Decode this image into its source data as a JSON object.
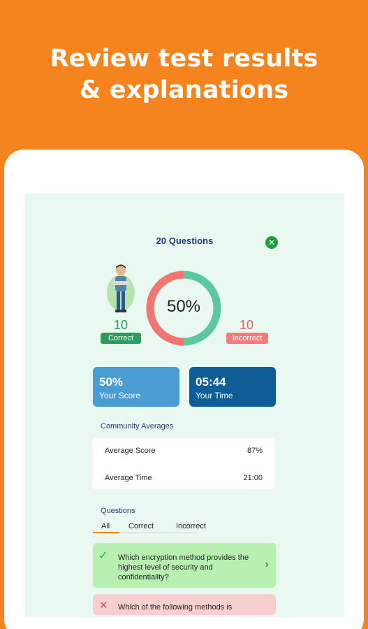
{
  "headline": {
    "line1": "Review test results",
    "line2": "& explanations"
  },
  "results": {
    "title": "20 Questions",
    "close_icon": "close-icon",
    "score_percent": 50,
    "score_label": "50%",
    "correct": {
      "count": "10",
      "label": "Correct"
    },
    "incorrect": {
      "count": "10",
      "label": "Incorrect"
    },
    "colors": {
      "correct": "#5BC8A0",
      "incorrect": "#F2766F",
      "accent": "#F5841F"
    },
    "score_card": {
      "value": "50%",
      "label": "Your Score"
    },
    "time_card": {
      "value": "05:44",
      "label": "Your Time"
    }
  },
  "community": {
    "title": "Community Averages",
    "rows": [
      {
        "label": "Average Score",
        "value": "87%"
      },
      {
        "label": "Average Time",
        "value": "21:00"
      }
    ]
  },
  "questions": {
    "title": "Questions",
    "tabs": [
      "All",
      "Correct",
      "Incorrect"
    ],
    "active_tab": "All",
    "items": [
      {
        "status": "correct",
        "icon": "check-icon",
        "text": "Which encryption method provides the highest level of security and confidentiality?"
      },
      {
        "status": "incorrect",
        "icon": "cross-icon",
        "text": "Which of the following methods is"
      }
    ]
  }
}
